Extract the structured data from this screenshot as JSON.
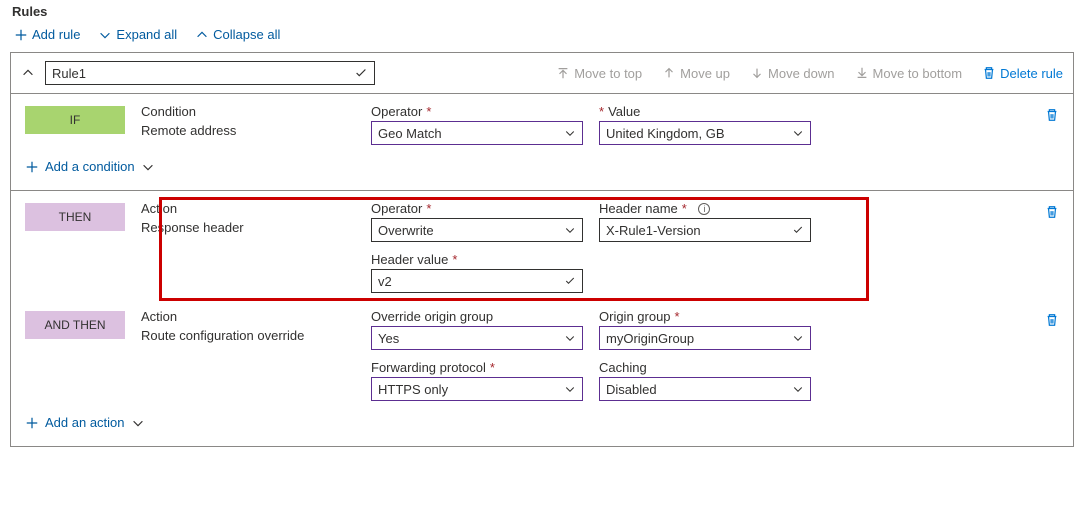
{
  "title": "Rules",
  "toolbar": {
    "add_rule": "Add rule",
    "expand_all": "Expand all",
    "collapse_all": "Collapse all"
  },
  "rule": {
    "name": "Rule1",
    "header_actions": {
      "move_top": "Move to top",
      "move_up": "Move up",
      "move_down": "Move down",
      "move_bottom": "Move to bottom",
      "delete": "Delete rule"
    },
    "if_block": {
      "badge": "IF",
      "condition_label": "Condition",
      "condition_value": "Remote address",
      "operator_label": "Operator",
      "operator_value": "Geo Match",
      "value_label": "Value",
      "value_value": "United Kingdom, GB",
      "add_condition": "Add a condition"
    },
    "then_block": {
      "badge": "THEN",
      "action_label": "Action",
      "action_value": "Response header",
      "operator_label": "Operator",
      "operator_value": "Overwrite",
      "header_name_label": "Header name",
      "header_name_value": "X-Rule1-Version",
      "header_value_label": "Header value",
      "header_value_value": "v2"
    },
    "andthen_block": {
      "badge": "AND THEN",
      "action_label": "Action",
      "action_value": "Route configuration override",
      "override_label": "Override origin group",
      "override_value": "Yes",
      "origin_group_label": "Origin group",
      "origin_group_value": "myOriginGroup",
      "forwarding_label": "Forwarding protocol",
      "forwarding_value": "HTTPS only",
      "caching_label": "Caching",
      "caching_value": "Disabled"
    },
    "add_action": "Add an action"
  }
}
